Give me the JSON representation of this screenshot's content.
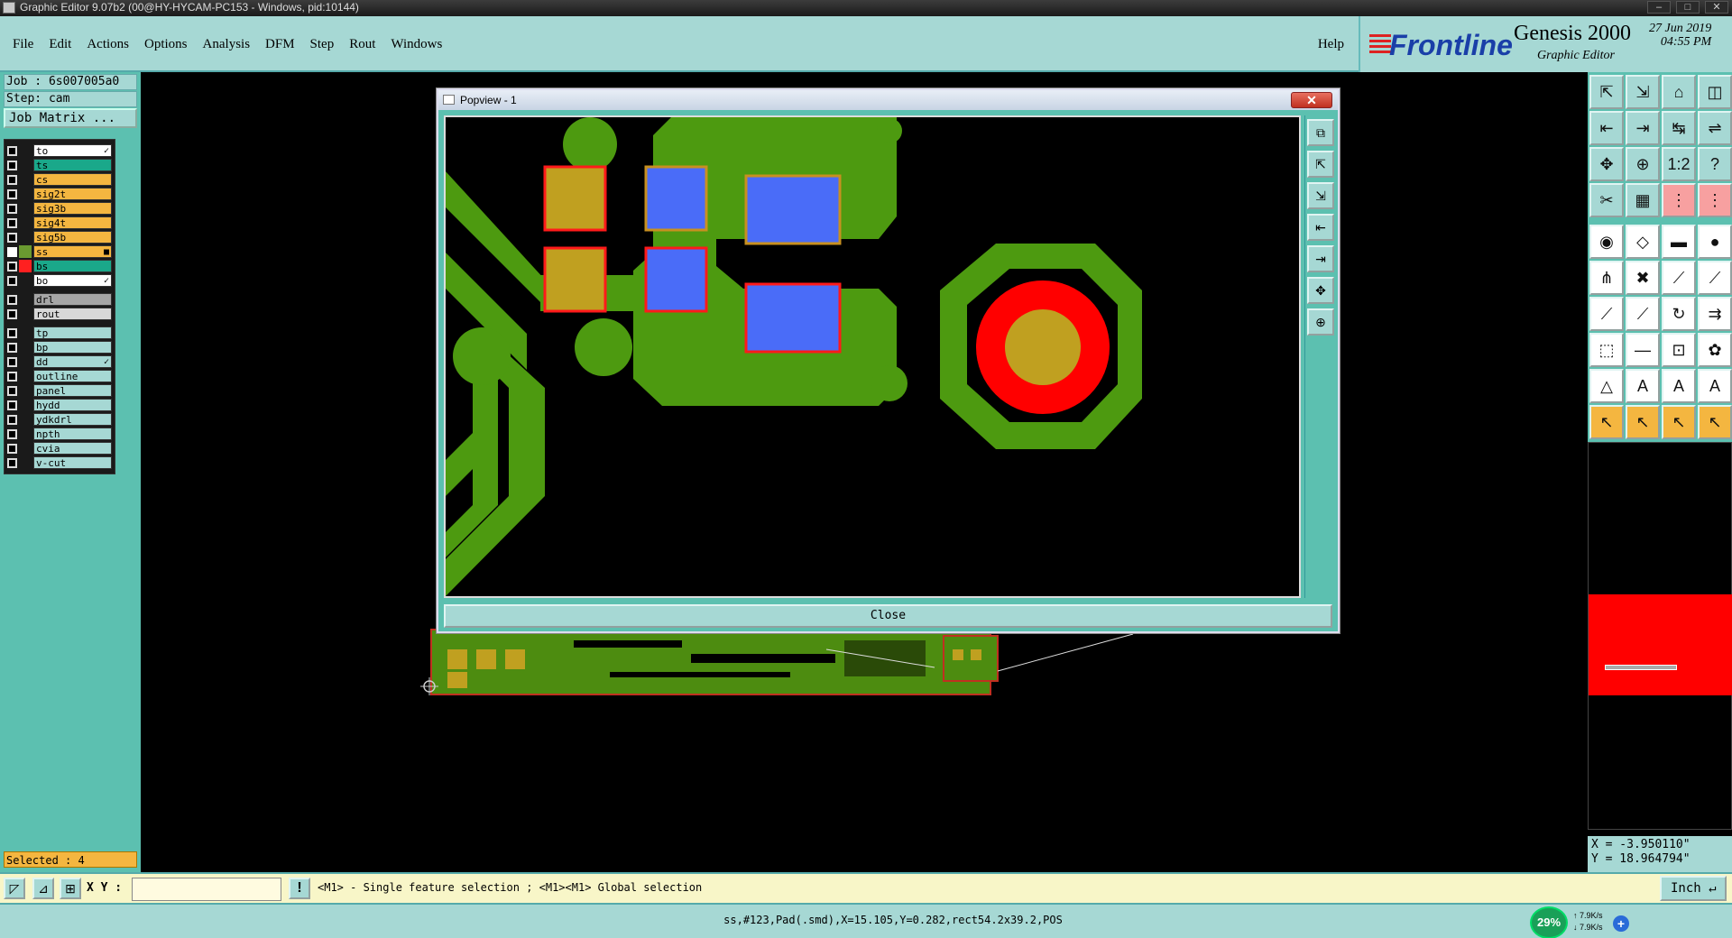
{
  "window": {
    "title": "Graphic Editor 9.07b2 (00@HY-HYCAM-PC153 - Windows, pid:10144)",
    "min": "–",
    "max": "□",
    "close": "✕"
  },
  "menu": {
    "items": [
      "File",
      "Edit",
      "Actions",
      "Options",
      "Analysis",
      "DFM",
      "Step",
      "Rout",
      "Windows"
    ],
    "help": "Help"
  },
  "logo": {
    "brand": "Frontline",
    "product": "Genesis 2000",
    "subtitle": "Graphic Editor",
    "date": "27 Jun 2019",
    "time": "04:55 PM"
  },
  "job": {
    "job": "Job : 6s007005a0",
    "step": "Step: cam",
    "matrix": "Job Matrix ..."
  },
  "layers": [
    {
      "name": "to",
      "color": "#ffffff",
      "mark": "✓",
      "checked": false,
      "swatch": ""
    },
    {
      "name": "ts",
      "color": "#1aa88a",
      "mark": "",
      "checked": false,
      "swatch": ""
    },
    {
      "name": "cs",
      "color": "#f4b640",
      "mark": "",
      "checked": false,
      "swatch": ""
    },
    {
      "name": "sig2t",
      "color": "#f4b640",
      "mark": "",
      "checked": false,
      "swatch": ""
    },
    {
      "name": "sig3b",
      "color": "#f4b640",
      "mark": "",
      "checked": false,
      "swatch": ""
    },
    {
      "name": "sig4t",
      "color": "#f4b640",
      "mark": "",
      "checked": false,
      "swatch": ""
    },
    {
      "name": "sig5b",
      "color": "#f4b640",
      "mark": "",
      "checked": false,
      "swatch": ""
    },
    {
      "name": "ss",
      "color": "#f4b640",
      "mark": "■",
      "checked": true,
      "swatch": "#6a9a30"
    },
    {
      "name": "bs",
      "color": "#1aa88a",
      "mark": "",
      "checked": false,
      "swatch": "#ff2020"
    },
    {
      "name": "bo",
      "color": "#ffffff",
      "mark": "✓",
      "checked": false,
      "swatch": ""
    },
    {
      "gap": true
    },
    {
      "name": "drl",
      "color": "#a6a6a6",
      "mark": "",
      "checked": false,
      "swatch": ""
    },
    {
      "name": "rout",
      "color": "#d8d8d8",
      "mark": "",
      "checked": false,
      "swatch": ""
    },
    {
      "gap": true
    },
    {
      "name": "tp",
      "color": "#a6d8d4",
      "mark": "",
      "checked": false,
      "swatch": ""
    },
    {
      "name": "bp",
      "color": "#a6d8d4",
      "mark": "",
      "checked": false,
      "swatch": ""
    },
    {
      "name": "dd",
      "color": "#a6d8d4",
      "mark": "✓",
      "checked": false,
      "swatch": ""
    },
    {
      "name": "outline",
      "color": "#a6d8d4",
      "mark": "",
      "checked": false,
      "swatch": ""
    },
    {
      "name": "panel",
      "color": "#a6d8d4",
      "mark": "",
      "checked": false,
      "swatch": ""
    },
    {
      "name": "hydd",
      "color": "#a6d8d4",
      "mark": "",
      "checked": false,
      "swatch": ""
    },
    {
      "name": "ydkdrl",
      "color": "#a6d8d4",
      "mark": "",
      "checked": false,
      "swatch": ""
    },
    {
      "name": "npth",
      "color": "#a6d8d4",
      "mark": "",
      "checked": false,
      "swatch": ""
    },
    {
      "name": "cvia",
      "color": "#a6d8d4",
      "mark": "",
      "checked": false,
      "swatch": ""
    },
    {
      "name": "v-cut",
      "color": "#a6d8d4",
      "mark": "",
      "checked": false,
      "swatch": ""
    }
  ],
  "selected": "Selected : 4",
  "tools": [
    {
      "icon": "⇱",
      "style": ""
    },
    {
      "icon": "⇲",
      "style": ""
    },
    {
      "icon": "⌂",
      "style": ""
    },
    {
      "icon": "◫",
      "style": ""
    },
    {
      "icon": "⇤",
      "style": ""
    },
    {
      "icon": "⇥",
      "style": ""
    },
    {
      "icon": "↹",
      "style": ""
    },
    {
      "icon": "⇌",
      "style": ""
    },
    {
      "icon": "✥",
      "style": ""
    },
    {
      "icon": "⊕",
      "style": ""
    },
    {
      "icon": "1:2",
      "style": ""
    },
    {
      "icon": "?",
      "style": ""
    },
    {
      "icon": "✂",
      "style": ""
    },
    {
      "icon": "▦",
      "style": ""
    },
    {
      "icon": "⋮",
      "style": "red"
    },
    {
      "icon": "⋮",
      "style": "red"
    },
    {
      "gap": true
    },
    {
      "icon": "◉",
      "style": "white"
    },
    {
      "icon": "◇",
      "style": "white"
    },
    {
      "icon": "▬",
      "style": "white"
    },
    {
      "icon": "●",
      "style": "white"
    },
    {
      "icon": "⋔",
      "style": "white"
    },
    {
      "icon": "✖",
      "style": "white"
    },
    {
      "icon": "⟋",
      "style": "white"
    },
    {
      "icon": "⟋",
      "style": "white"
    },
    {
      "icon": "⟋",
      "style": "white"
    },
    {
      "icon": "⟋",
      "style": "white"
    },
    {
      "icon": "↻",
      "style": "white"
    },
    {
      "icon": "⇉",
      "style": "white"
    },
    {
      "icon": "⬚",
      "style": "white"
    },
    {
      "icon": "—",
      "style": "white"
    },
    {
      "icon": "⊡",
      "style": "white"
    },
    {
      "icon": "✿",
      "style": "white"
    },
    {
      "icon": "△",
      "style": "white"
    },
    {
      "icon": "A",
      "style": "white"
    },
    {
      "icon": "A",
      "style": "white"
    },
    {
      "icon": "A",
      "style": "white"
    },
    {
      "icon": "↖",
      "style": "orange"
    },
    {
      "icon": "↖",
      "style": "orange"
    },
    {
      "icon": "↖",
      "style": "orange"
    },
    {
      "icon": "↖",
      "style": "orange"
    }
  ],
  "coords": {
    "x": "X = -3.950110\"",
    "y": "Y = 18.964794\""
  },
  "command": {
    "xy_label": "X Y :",
    "xy_value": "",
    "message": "<M1> - Single feature selection ; <M1><M1> Global selection",
    "unit": "Inch ↵"
  },
  "status": "ss,#123,Pad(.smd),X=15.105,Y=0.282,rect54.2x39.2,POS",
  "net": {
    "percent": "29%",
    "up": "7.9K/s",
    "down": "7.9K/s",
    "plus": "+"
  },
  "popview": {
    "title": "Popview - 1",
    "close_x": "✕",
    "close_button": "Close",
    "tools": [
      "⧉",
      "⇱",
      "⇲",
      "⇤",
      "⇥",
      "✥",
      "⊕"
    ]
  }
}
